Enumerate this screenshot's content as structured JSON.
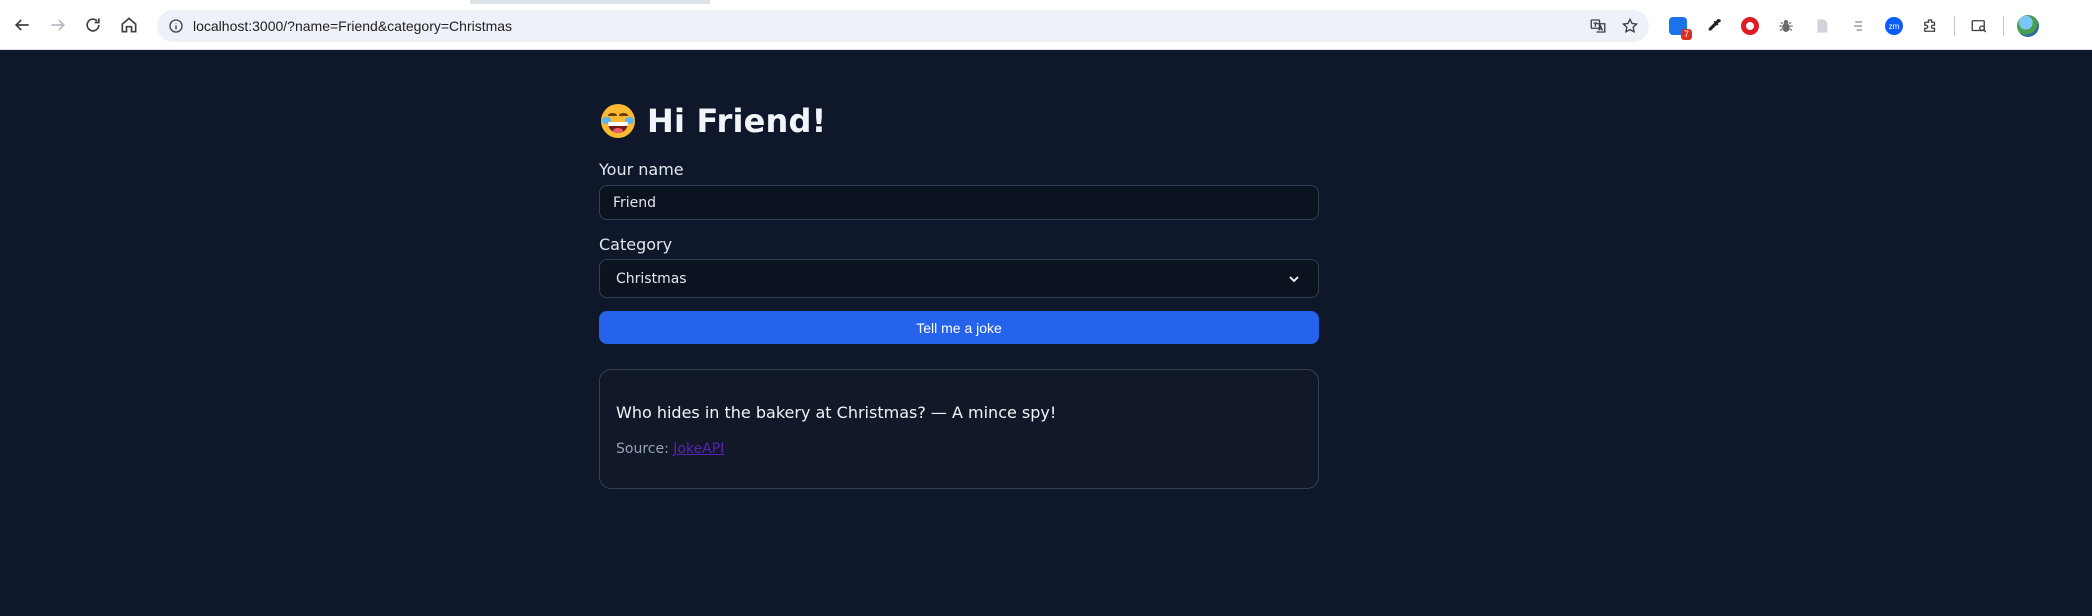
{
  "browser": {
    "url": "localhost:3000/?name=Friend&category=Christmas",
    "extensions": [
      {
        "name": "translate-icon"
      },
      {
        "name": "bookmark-star-icon"
      }
    ],
    "ext_badge": "7",
    "ext_zm_label": "zm"
  },
  "page": {
    "greeting": "Hi Friend!",
    "emoji": "laughing-face-with-tears",
    "name_label": "Your name",
    "name_value": "Friend",
    "category_label": "Category",
    "category_selected": "Christmas",
    "button_label": "Tell me a joke",
    "joke_text": "Who hides in the bakery at Christmas? — A mince spy!",
    "source_prefix": "Source:",
    "source_link": "JokeAPI"
  },
  "colors": {
    "background": "#0f172a",
    "accent": "#2563eb",
    "card_border": "#334155",
    "link": "#5b21b6"
  }
}
